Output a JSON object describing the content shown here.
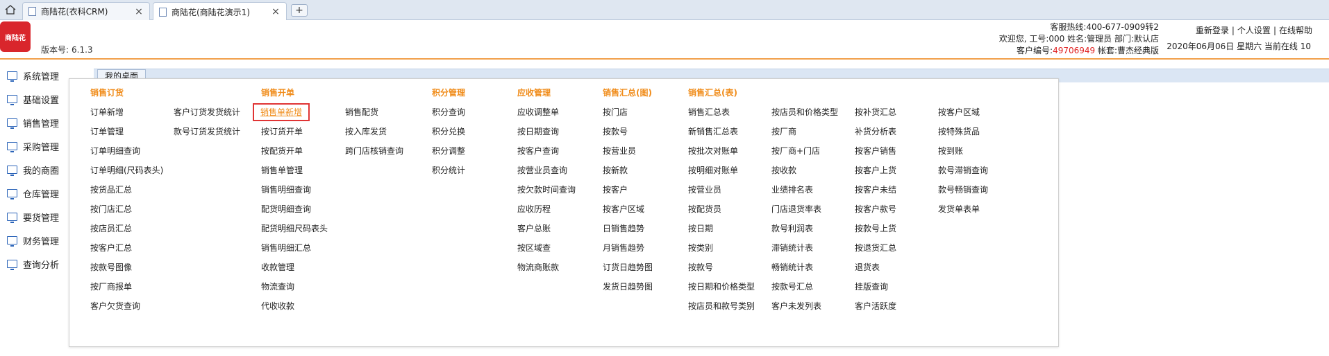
{
  "browser": {
    "tabs": [
      {
        "label": "商陆花(衣科CRM)"
      },
      {
        "label": "商陆花(商陆花演示1)"
      }
    ],
    "new_tab": "+",
    "close": "×"
  },
  "app": {
    "logo_text": "商陆花",
    "version_label": "版本号:",
    "version_value": "6.1.3",
    "hotline": "客服热线:400-677-0909转2",
    "welcome": "欢迎您, 工号:000 姓名:管理员 部门:默认店",
    "customer_no_label": "客户编号:",
    "customer_no": "49706949",
    "package": " 帐套:曹杰经典版",
    "links": [
      "重新登录",
      "个人设置",
      "在线帮助"
    ],
    "date": "2020年06月06日 星期六 当前在线 10"
  },
  "sidebar": {
    "items": [
      {
        "label": "系统管理"
      },
      {
        "label": "基础设置"
      },
      {
        "label": "销售管理"
      },
      {
        "label": "采购管理"
      },
      {
        "label": "我的商圈"
      },
      {
        "label": "仓库管理"
      },
      {
        "label": "要货管理"
      },
      {
        "label": "财务管理"
      },
      {
        "label": "查询分析"
      }
    ]
  },
  "content_tab": "我的桌面",
  "menu": {
    "headers": {
      "order": "销售订货",
      "sale": "销售开单",
      "points": "积分管理",
      "receivable": "应收管理",
      "summary_chart": "销售汇总(图)",
      "summary_table": "销售汇总(表)"
    },
    "col1": [
      "订单新增",
      "订单管理",
      "订单明细查询",
      "订单明细(尺码表头)",
      "按货品汇总",
      "按门店汇总",
      "按店员汇总",
      "按客户汇总",
      "按款号图像",
      "按厂商报单",
      "客户欠货查询"
    ],
    "col2": [
      "客户订货发货统计",
      "款号订货发货统计"
    ],
    "col3": [
      "销售单新增",
      "按订货开单",
      "按配货开单",
      "销售单管理",
      "销售明细查询",
      "配货明细查询",
      "配货明细尺码表头",
      "销售明细汇总",
      "收款管理",
      "物流查询",
      "代收收款"
    ],
    "col4": [
      "销售配货",
      "按入库发货",
      "跨门店核销查询"
    ],
    "col5": [
      "积分查询",
      "积分兑换",
      "积分调整",
      "积分统计"
    ],
    "col6": [
      "应收调整单",
      "按日期查询",
      "按客户查询",
      "按营业员查询",
      "按欠款时间查询",
      "应收历程",
      "客户总账",
      "按区域查",
      "物流商账款"
    ],
    "col7": [
      "按门店",
      "按款号",
      "按营业员",
      "按新款",
      "按客户",
      "按客户区域",
      "日销售趋势",
      "月销售趋势",
      "订货日趋势图",
      "发货日趋势图"
    ],
    "col8": [
      "销售汇总表",
      "新销售汇总表",
      "按批次对账单",
      "按明细对账单",
      "按营业员",
      "按配货员",
      "按日期",
      "按类别",
      "按款号",
      "按日期和价格类型",
      "按店员和款号类别"
    ],
    "col9": [
      "按店员和价格类型",
      "按厂商",
      "按厂商+门店",
      "按收款",
      "业绩排名表",
      "门店退货率表",
      "款号利润表",
      "滞销统计表",
      "畅销统计表",
      "按款号汇总",
      "客户未发列表"
    ],
    "col10": [
      "按补货汇总",
      "补货分析表",
      "按客户销售",
      "按客户上货",
      "按客户未结",
      "按客户款号",
      "按款号上货",
      "按退货汇总",
      "退货表",
      "挂版查询",
      "客户活跃度"
    ],
    "col11": [
      "按客户区域",
      "按特殊货品",
      "按到账",
      "款号滞销查询",
      "款号畅销查询",
      "发货单表单"
    ]
  }
}
